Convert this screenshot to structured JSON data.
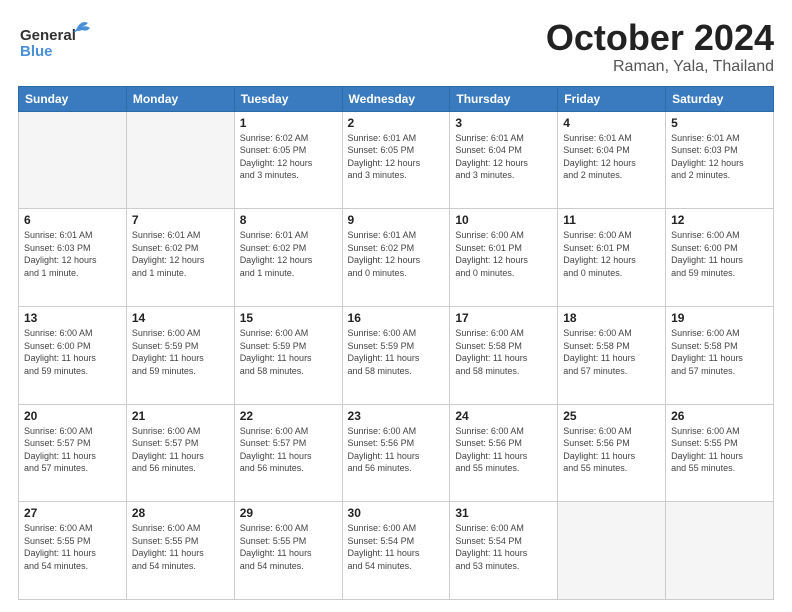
{
  "header": {
    "title": "October 2024",
    "subtitle": "Raman, Yala, Thailand",
    "logo_line1": "General",
    "logo_line2": "Blue"
  },
  "days_of_week": [
    "Sunday",
    "Monday",
    "Tuesday",
    "Wednesday",
    "Thursday",
    "Friday",
    "Saturday"
  ],
  "weeks": [
    [
      {
        "day": "",
        "info": ""
      },
      {
        "day": "",
        "info": ""
      },
      {
        "day": "1",
        "info": "Sunrise: 6:02 AM\nSunset: 6:05 PM\nDaylight: 12 hours\nand 3 minutes."
      },
      {
        "day": "2",
        "info": "Sunrise: 6:01 AM\nSunset: 6:05 PM\nDaylight: 12 hours\nand 3 minutes."
      },
      {
        "day": "3",
        "info": "Sunrise: 6:01 AM\nSunset: 6:04 PM\nDaylight: 12 hours\nand 3 minutes."
      },
      {
        "day": "4",
        "info": "Sunrise: 6:01 AM\nSunset: 6:04 PM\nDaylight: 12 hours\nand 2 minutes."
      },
      {
        "day": "5",
        "info": "Sunrise: 6:01 AM\nSunset: 6:03 PM\nDaylight: 12 hours\nand 2 minutes."
      }
    ],
    [
      {
        "day": "6",
        "info": "Sunrise: 6:01 AM\nSunset: 6:03 PM\nDaylight: 12 hours\nand 1 minute."
      },
      {
        "day": "7",
        "info": "Sunrise: 6:01 AM\nSunset: 6:02 PM\nDaylight: 12 hours\nand 1 minute."
      },
      {
        "day": "8",
        "info": "Sunrise: 6:01 AM\nSunset: 6:02 PM\nDaylight: 12 hours\nand 1 minute."
      },
      {
        "day": "9",
        "info": "Sunrise: 6:01 AM\nSunset: 6:02 PM\nDaylight: 12 hours\nand 0 minutes."
      },
      {
        "day": "10",
        "info": "Sunrise: 6:00 AM\nSunset: 6:01 PM\nDaylight: 12 hours\nand 0 minutes."
      },
      {
        "day": "11",
        "info": "Sunrise: 6:00 AM\nSunset: 6:01 PM\nDaylight: 12 hours\nand 0 minutes."
      },
      {
        "day": "12",
        "info": "Sunrise: 6:00 AM\nSunset: 6:00 PM\nDaylight: 11 hours\nand 59 minutes."
      }
    ],
    [
      {
        "day": "13",
        "info": "Sunrise: 6:00 AM\nSunset: 6:00 PM\nDaylight: 11 hours\nand 59 minutes."
      },
      {
        "day": "14",
        "info": "Sunrise: 6:00 AM\nSunset: 5:59 PM\nDaylight: 11 hours\nand 59 minutes."
      },
      {
        "day": "15",
        "info": "Sunrise: 6:00 AM\nSunset: 5:59 PM\nDaylight: 11 hours\nand 58 minutes."
      },
      {
        "day": "16",
        "info": "Sunrise: 6:00 AM\nSunset: 5:59 PM\nDaylight: 11 hours\nand 58 minutes."
      },
      {
        "day": "17",
        "info": "Sunrise: 6:00 AM\nSunset: 5:58 PM\nDaylight: 11 hours\nand 58 minutes."
      },
      {
        "day": "18",
        "info": "Sunrise: 6:00 AM\nSunset: 5:58 PM\nDaylight: 11 hours\nand 57 minutes."
      },
      {
        "day": "19",
        "info": "Sunrise: 6:00 AM\nSunset: 5:58 PM\nDaylight: 11 hours\nand 57 minutes."
      }
    ],
    [
      {
        "day": "20",
        "info": "Sunrise: 6:00 AM\nSunset: 5:57 PM\nDaylight: 11 hours\nand 57 minutes."
      },
      {
        "day": "21",
        "info": "Sunrise: 6:00 AM\nSunset: 5:57 PM\nDaylight: 11 hours\nand 56 minutes."
      },
      {
        "day": "22",
        "info": "Sunrise: 6:00 AM\nSunset: 5:57 PM\nDaylight: 11 hours\nand 56 minutes."
      },
      {
        "day": "23",
        "info": "Sunrise: 6:00 AM\nSunset: 5:56 PM\nDaylight: 11 hours\nand 56 minutes."
      },
      {
        "day": "24",
        "info": "Sunrise: 6:00 AM\nSunset: 5:56 PM\nDaylight: 11 hours\nand 55 minutes."
      },
      {
        "day": "25",
        "info": "Sunrise: 6:00 AM\nSunset: 5:56 PM\nDaylight: 11 hours\nand 55 minutes."
      },
      {
        "day": "26",
        "info": "Sunrise: 6:00 AM\nSunset: 5:55 PM\nDaylight: 11 hours\nand 55 minutes."
      }
    ],
    [
      {
        "day": "27",
        "info": "Sunrise: 6:00 AM\nSunset: 5:55 PM\nDaylight: 11 hours\nand 54 minutes."
      },
      {
        "day": "28",
        "info": "Sunrise: 6:00 AM\nSunset: 5:55 PM\nDaylight: 11 hours\nand 54 minutes."
      },
      {
        "day": "29",
        "info": "Sunrise: 6:00 AM\nSunset: 5:55 PM\nDaylight: 11 hours\nand 54 minutes."
      },
      {
        "day": "30",
        "info": "Sunrise: 6:00 AM\nSunset: 5:54 PM\nDaylight: 11 hours\nand 54 minutes."
      },
      {
        "day": "31",
        "info": "Sunrise: 6:00 AM\nSunset: 5:54 PM\nDaylight: 11 hours\nand 53 minutes."
      },
      {
        "day": "",
        "info": ""
      },
      {
        "day": "",
        "info": ""
      }
    ]
  ]
}
